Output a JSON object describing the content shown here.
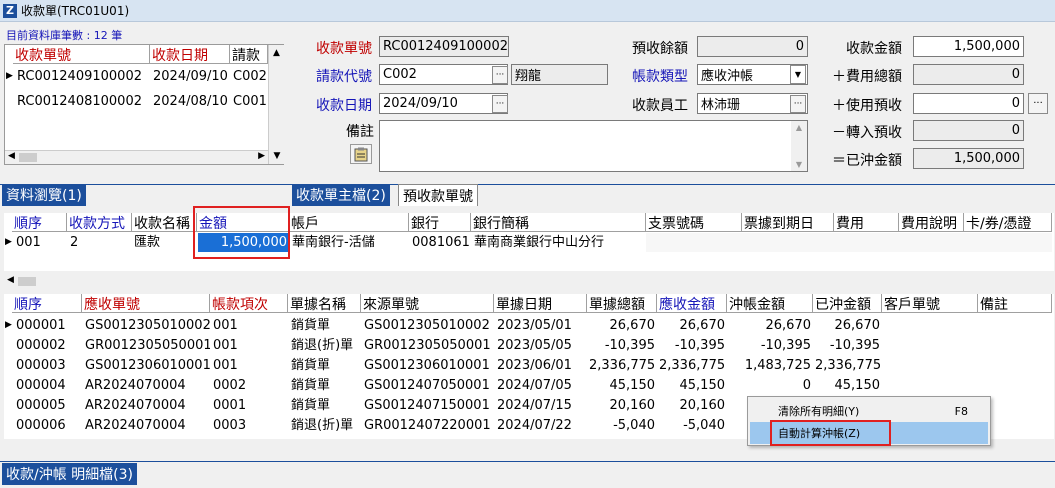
{
  "window": {
    "title": "收款單(TRC01U01)"
  },
  "browse": {
    "record_count_label": "目前資料庫筆數 : 12 筆",
    "columns": [
      "收款單號",
      "收款日期",
      "請款"
    ],
    "rows": [
      {
        "no": "RC0012409100002",
        "date": "2024/09/10",
        "code": "C002"
      },
      {
        "no": "RC0012408100002",
        "date": "2024/08/10",
        "code": "C001"
      }
    ],
    "tab_label": "資料瀏覽(1)"
  },
  "header_form": {
    "receipt_no_label": "收款單號",
    "receipt_no": "RC0012409100002",
    "customer_code_label": "請款代號",
    "customer_code": "C002",
    "customer_name": "翔龍",
    "receipt_date_label": "收款日期",
    "receipt_date": "2024/09/10",
    "note_label": "備註",
    "note": "",
    "prepaid_balance_label": "預收餘額",
    "prepaid_balance": "0",
    "receipt_type_label": "帳款類型",
    "receipt_type": "應收沖帳",
    "collector_label": "收款員工",
    "collector": "林沛珊",
    "amount_label": "收款金額",
    "amount": "1,500,000",
    "fee_total_label": "＋費用總額",
    "fee_total": "0",
    "use_prepaid_label": "＋使用預收",
    "use_prepaid": "0",
    "transfer_prepaid_label": "－轉入預收",
    "transfer_prepaid": "0",
    "written_off_label": "＝已沖金額",
    "written_off": "1,500,000"
  },
  "tabs": {
    "main": "收款單主檔(2)",
    "prepaid": "預收款單號"
  },
  "payment_grid": {
    "columns": [
      "順序",
      "收款方式",
      "收款名稱",
      "金額",
      "帳戶",
      "銀行",
      "銀行簡稱",
      "支票號碼",
      "票據到期日",
      "費用",
      "費用說明",
      "卡/券/憑證"
    ],
    "rows": [
      {
        "seq": "001",
        "method": "2",
        "name": "匯款",
        "amount": "1,500,000",
        "account": "華南銀行-活儲",
        "bank": "0081061",
        "bank_short": "華南商業銀行中山分行"
      }
    ]
  },
  "detail_grid": {
    "columns": [
      "順序",
      "應收單號",
      "帳款項次",
      "單據名稱",
      "來源單號",
      "單據日期",
      "單據總額",
      "應收金額",
      "沖帳金額",
      "已沖金額",
      "客戶單號",
      "備註"
    ],
    "rows": [
      {
        "seq": "000001",
        "ar_no": "GS0012305010002",
        "item": "001",
        "doc": "銷貨單",
        "src": "GS0012305010002",
        "date": "2023/05/01",
        "total": "26,670",
        "ar": "26,670",
        "wo": "26,670",
        "done": "26,670"
      },
      {
        "seq": "000002",
        "ar_no": "GR0012305050001",
        "item": "001",
        "doc": "銷退(折)單",
        "src": "GR0012305050001",
        "date": "2023/05/05",
        "total": "-10,395",
        "ar": "-10,395",
        "wo": "-10,395",
        "done": "-10,395"
      },
      {
        "seq": "000003",
        "ar_no": "GS0012306010001",
        "item": "001",
        "doc": "銷貨單",
        "src": "GS0012306010001",
        "date": "2023/06/01",
        "total": "2,336,775",
        "ar": "2,336,775",
        "wo": "1,483,725",
        "done": "2,336,775"
      },
      {
        "seq": "000004",
        "ar_no": "AR2024070004",
        "item": "0002",
        "doc": "銷貨單",
        "src": "GS0012407050001",
        "date": "2024/07/05",
        "total": "45,150",
        "ar": "45,150",
        "wo": "0",
        "done": "45,150"
      },
      {
        "seq": "000005",
        "ar_no": "AR2024070004",
        "item": "0001",
        "doc": "銷貨單",
        "src": "GS0012407150001",
        "date": "2024/07/15",
        "total": "20,160",
        "ar": "20,160",
        "wo": "",
        "done": ""
      },
      {
        "seq": "000006",
        "ar_no": "AR2024070004",
        "item": "0003",
        "doc": "銷退(折)單",
        "src": "GR0012407220001",
        "date": "2024/07/22",
        "total": "-5,040",
        "ar": "-5,040",
        "wo": "",
        "done": ""
      }
    ],
    "tab_label": "收款/沖帳 明細檔(3)"
  },
  "context_menu": {
    "items": [
      {
        "label": "清除所有明細(Y)",
        "shortcut": "F8"
      },
      {
        "label": "自動計算沖帳(Z)",
        "shortcut": ""
      }
    ]
  },
  "colors": {
    "accent_blue": "#1c4f9c",
    "label_blue": "#1515b8",
    "label_red": "#c00000",
    "highlight_red": "#e02020",
    "selected_cell": "#1a6fd6"
  },
  "icons": [
    "app-z-icon",
    "ellipsis-icon",
    "dropdown-arrow-icon",
    "clipboard-icon",
    "row-pointer-icon",
    "scroll-arrow-icon"
  ]
}
